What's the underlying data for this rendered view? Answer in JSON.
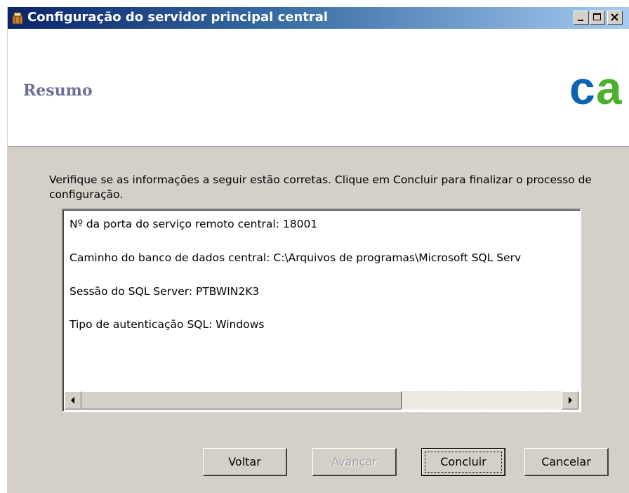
{
  "window": {
    "title": "Configuração do servidor principal central"
  },
  "header": {
    "page_title": "Resumo",
    "logo_text": "ca",
    "logo_colors": [
      "#0b63b3",
      "#4caf2e"
    ]
  },
  "instructions": "Verifique se as informações a seguir estão corretas. Clique em Concluir para finalizar o processo de configuração.",
  "summary": {
    "lines": [
      "Nº da porta do serviço remoto central: 18001",
      "Caminho do banco de dados central: C:\\Arquivos de programas\\Microsoft SQL Serv",
      "Sessão do SQL Server: PTBWIN2K3",
      "Tipo de autenticação SQL: Windows"
    ]
  },
  "buttons": {
    "back": "Voltar",
    "next": "Avançar",
    "finish": "Concluir",
    "cancel": "Cancelar"
  },
  "icons": {
    "app": "installer-icon",
    "minimize": "minimize-icon",
    "maximize": "maximize-icon",
    "close": "close-icon",
    "scroll_left": "arrow-left-icon",
    "scroll_right": "arrow-right-icon"
  }
}
